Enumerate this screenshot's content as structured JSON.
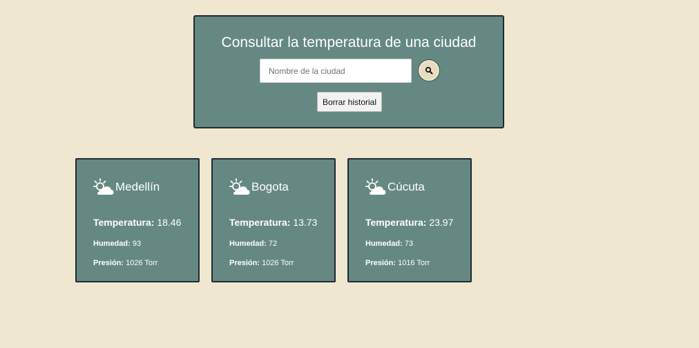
{
  "search": {
    "title": "Consultar la temperatura de una ciudad",
    "placeholder": "Nombre de la ciudad",
    "value": "",
    "search_icon": "search-icon",
    "clear_label": "Borrar historial"
  },
  "labels": {
    "temperature": "Temperatura:",
    "humidity": "Humedad:",
    "pressure": "Presión:"
  },
  "cities": [
    {
      "name": "Medellín",
      "temperature": "18.46",
      "humidity": "93",
      "pressure": "1026 Torr",
      "icon": "partly-cloudy-icon"
    },
    {
      "name": "Bogota",
      "temperature": "13.73",
      "humidity": "72",
      "pressure": "1026 Torr",
      "icon": "partly-cloudy-icon"
    },
    {
      "name": "Cúcuta",
      "temperature": "23.97",
      "humidity": "73",
      "pressure": "1016 Torr",
      "icon": "partly-cloudy-icon"
    }
  ],
  "colors": {
    "background": "#efe7d0",
    "panel": "#658982",
    "border": "#1f2a33",
    "text": "#ffffff"
  }
}
